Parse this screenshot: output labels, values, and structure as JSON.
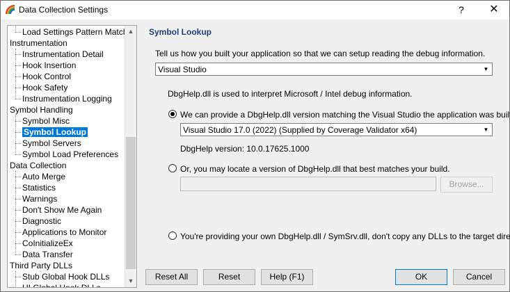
{
  "window": {
    "title": "Data Collection Settings",
    "help_glyph": "?",
    "close_glyph": "✕"
  },
  "tree": {
    "items": [
      {
        "label": "Load Settings Pattern Match",
        "level": 1
      },
      {
        "label": "Instrumentation",
        "level": 0
      },
      {
        "label": "Instrumentation Detail",
        "level": 1
      },
      {
        "label": "Hook Insertion",
        "level": 1
      },
      {
        "label": "Hook Control",
        "level": 1
      },
      {
        "label": "Hook Safety",
        "level": 1
      },
      {
        "label": "Instrumentation Logging",
        "level": 1
      },
      {
        "label": "Symbol Handling",
        "level": 0
      },
      {
        "label": "Symbol Misc",
        "level": 1
      },
      {
        "label": "Symbol Lookup",
        "level": 1,
        "selected": true
      },
      {
        "label": "Symbol Servers",
        "level": 1
      },
      {
        "label": "Symbol Load Preferences",
        "level": 1
      },
      {
        "label": "Data Collection",
        "level": 0
      },
      {
        "label": "Auto Merge",
        "level": 1
      },
      {
        "label": "Statistics",
        "level": 1
      },
      {
        "label": "Warnings",
        "level": 1
      },
      {
        "label": "Don't Show Me Again",
        "level": 1
      },
      {
        "label": "Diagnostic",
        "level": 1
      },
      {
        "label": "Applications to Monitor",
        "level": 1
      },
      {
        "label": "CoInitializeEx",
        "level": 1
      },
      {
        "label": "Data Transfer",
        "level": 1
      },
      {
        "label": "Third Party DLLs",
        "level": 0
      },
      {
        "label": "Stub Global Hook DLLs",
        "level": 1
      },
      {
        "label": "UI Global Hook DLLs",
        "level": 1
      }
    ]
  },
  "panel": {
    "section_title": "Symbol Lookup",
    "intro": "Tell us how you built your application so that we can setup reading the debug information.",
    "build_tool": "Visual Studio",
    "dbghelp_info": "DbgHelp.dll is used to interpret Microsoft / Intel debug information.",
    "option1_label": "We can provide a DbgHelp.dll version matching the Visual Studio the application was built with.",
    "option1_selected": true,
    "vs_version": "Visual Studio 17.0 (2022) (Supplied by  Coverage Validator x64)",
    "dbghelp_version": "DbgHelp version: 10.0.17625.1000",
    "option2_label": "Or, you may locate a version of DbgHelp.dll that best matches your build.",
    "path_value": "",
    "browse_label": "Browse...",
    "option3_label": "You're providing your own DbgHelp.dll / SymSrv.dll, don't copy any DLLs to the target directory"
  },
  "buttons": {
    "reset_all": "Reset All",
    "reset": "Reset",
    "help": "Help (F1)",
    "ok": "OK",
    "cancel": "Cancel"
  },
  "colors": {
    "section_title": "#1e3f7a",
    "selection": "#0078d7"
  }
}
